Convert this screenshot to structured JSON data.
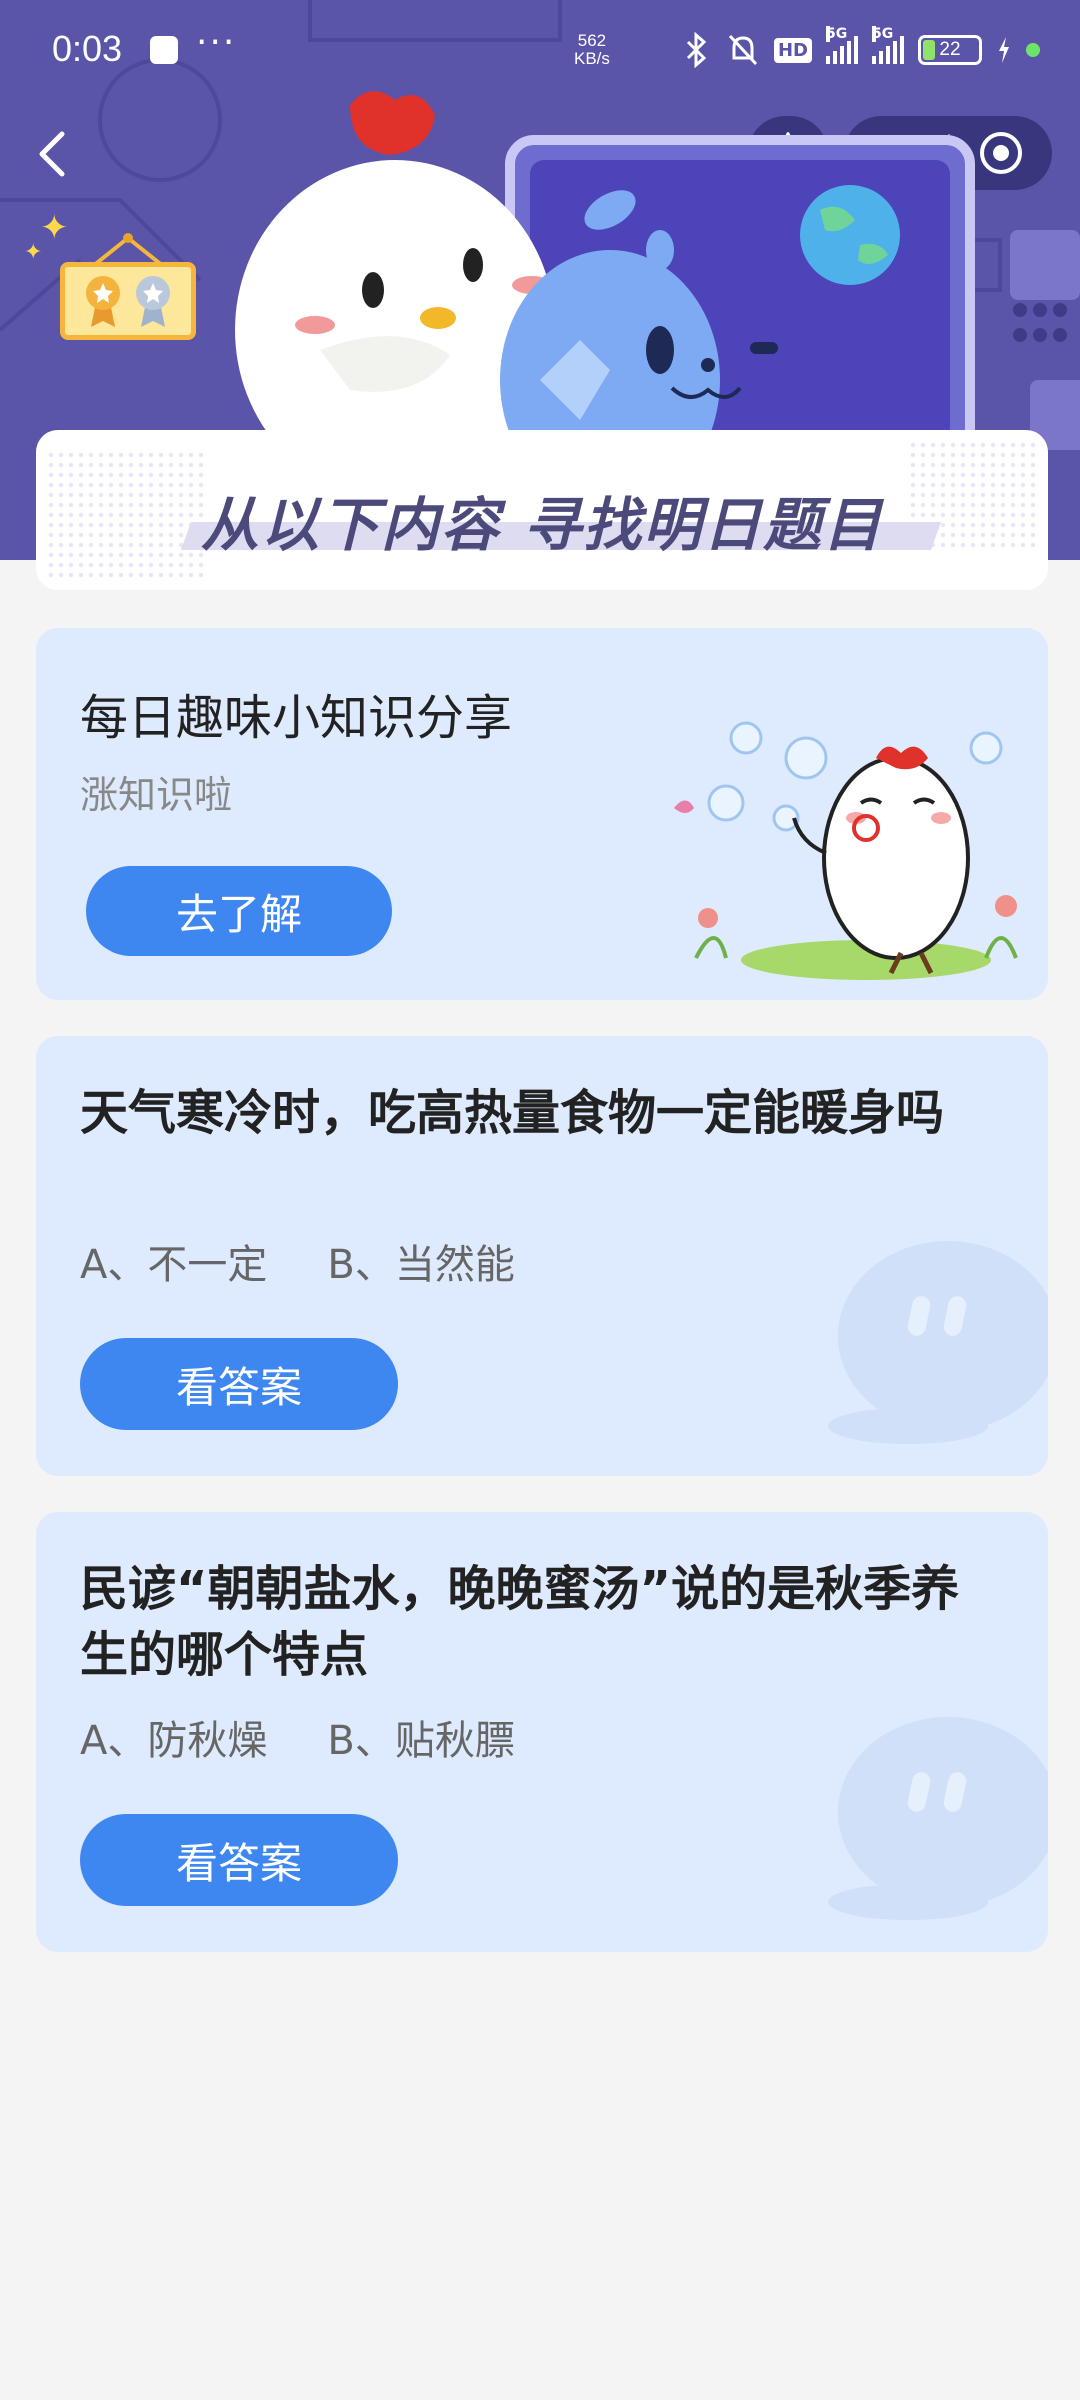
{
  "status_bar": {
    "time": "0:03",
    "more": "···",
    "speed_value": "562",
    "speed_unit": "KB/s",
    "hd": "HD",
    "net1": "5G",
    "net2": "5G",
    "battery": "22"
  },
  "nav": {
    "more": "•••"
  },
  "banner": {
    "title": "从以下内容  寻找明日题目"
  },
  "card_knowledge": {
    "heading": "每日趣味小知识分享",
    "subtitle": "涨知识啦",
    "button": "去了解"
  },
  "questions": [
    {
      "question": "天气寒冷时，吃高热量食物一定能暖身吗",
      "option_a": "A、不一定",
      "option_b": "B、当然能",
      "button": "看答案"
    },
    {
      "question": "民谚“朝朝盐水，晚晚蜜汤”说的是秋季养生的哪个特点",
      "option_a": "A、防秋燥",
      "option_b": "B、贴秋膘",
      "button": "看答案"
    }
  ],
  "colors": {
    "banner": "#5a55a8",
    "card": "#deeafd",
    "button": "#3e87f1",
    "page": "#f4f4f4"
  }
}
